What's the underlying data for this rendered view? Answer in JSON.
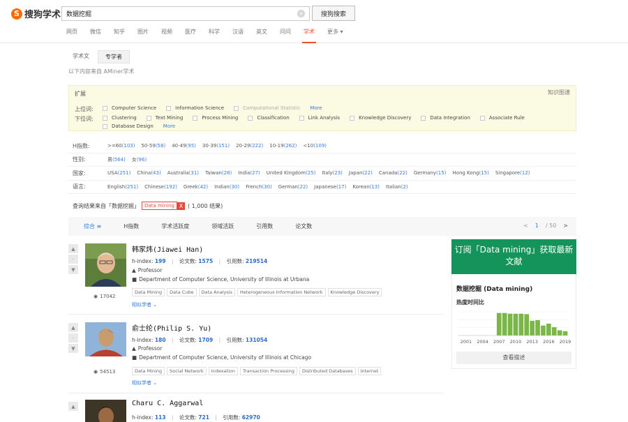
{
  "header": {
    "logo_text": "搜狗学术",
    "search_value": "数据挖掘",
    "search_button": "搜狗搜索",
    "nav": [
      "网页",
      "微信",
      "知乎",
      "图片",
      "视频",
      "医疗",
      "科学",
      "汉语",
      "英文",
      "问问",
      "学术",
      "更多 ▾"
    ],
    "active_nav": "学术"
  },
  "subtabs": [
    "学术文",
    "专学者"
  ],
  "source_line": "以下内容来自 AMiner学术",
  "expand": {
    "label": "扩展",
    "kg_link": "知识图谱",
    "upper_label": "上位词:",
    "upper_terms": [
      "Computer Science",
      "Information Science",
      "Computational Statistic",
      "More"
    ],
    "lower_label": "下位词:",
    "lower_terms_1": [
      "Clustering",
      "Text Mining",
      "Process Mining",
      "Classification",
      "Link Analysis",
      "Knowledge Discovery",
      "Data Integration",
      "Associate Rule"
    ],
    "lower_terms_2": [
      "Database Design",
      "More"
    ]
  },
  "filters": [
    {
      "label": "H指数:",
      "items": [
        [
          ">=60",
          "(103)"
        ],
        [
          "50-59",
          "(58)"
        ],
        [
          "40-49",
          "(95)"
        ],
        [
          "30-39",
          "(151)"
        ],
        [
          "20-29",
          "(222)"
        ],
        [
          "10-19",
          "(262)"
        ],
        [
          "<10",
          "(109)"
        ]
      ]
    },
    {
      "label": "性别:",
      "items": [
        [
          "男",
          "(564)"
        ],
        [
          "女",
          "(96)"
        ]
      ]
    },
    {
      "label": "国家:",
      "items": [
        [
          "USA",
          "(251)"
        ],
        [
          "China",
          "(43)"
        ],
        [
          "Australia",
          "(31)"
        ],
        [
          "Taiwan",
          "(28)"
        ],
        [
          "India",
          "(27)"
        ],
        [
          "United Kingdom",
          "(25)"
        ],
        [
          "Italy",
          "(23)"
        ],
        [
          "Japan",
          "(22)"
        ],
        [
          "Canada",
          "(22)"
        ],
        [
          "Germany",
          "(15)"
        ],
        [
          "Hong Kong",
          "(15)"
        ],
        [
          "Singapore",
          "(12)"
        ]
      ]
    },
    {
      "label": "语言:",
      "items": [
        [
          "English",
          "(251)"
        ],
        [
          "Chinese",
          "(192)"
        ],
        [
          "Greek",
          "(42)"
        ],
        [
          "Indian",
          "(30)"
        ],
        [
          "French",
          "(30)"
        ],
        [
          "German",
          "(22)"
        ],
        [
          "Japanese",
          "(17)"
        ],
        [
          "Korean",
          "(13)"
        ],
        [
          "Italian",
          "(2)"
        ]
      ]
    }
  ],
  "status": {
    "prefix": "查询结果来自「数据挖掘」",
    "tag": "Data mining",
    "x": "X",
    "count": "( 1,000 结果)"
  },
  "sortbar": {
    "items": [
      "综合 ≡",
      "H指数",
      "学术活跃度",
      "领域活跃",
      "引用数",
      "论文数"
    ],
    "pager_prev": "<",
    "pager_cur": "1",
    "pager_total": "/ 50",
    "pager_next": ">"
  },
  "people": [
    {
      "name": "韩家炜(Jiawei Han)",
      "hindex": "199",
      "papers": "1575",
      "citations": "219514",
      "role": "Professor",
      "affil": "Department of Computer Science, University of Illinois at Urbana",
      "tags": [
        "Data Mining",
        "Data Cube",
        "Data Analysis",
        "Heterogeneous Information Network",
        "Knowledge Discovery"
      ],
      "views": "17042",
      "more": "相似学者 ⌄"
    },
    {
      "name": "俞士纶(Philip S. Yu)",
      "hindex": "180",
      "papers": "1709",
      "citations": "131054",
      "role": "Professor",
      "affil": "Department of Computer Science, University of Illinois at Chicago",
      "tags": [
        "Data Mining",
        "Social Network",
        "Indexation",
        "Transaction Processing",
        "Distributed Databases",
        "Internet"
      ],
      "views": "54513",
      "more": "相似学者 ⌄"
    },
    {
      "name": "Charu C. Aggarwal",
      "hindex": "113",
      "papers": "721",
      "citations": "62970"
    }
  ],
  "labels": {
    "hindex": "h-index:",
    "papers": "论文数:",
    "citations": "引用数:",
    "sep": "|"
  },
  "panel": {
    "subscribe": "订阅「Data mining」获取最新文献",
    "trend_title": "数据挖掘 (Data mining)",
    "trend_sub": "热度时间比",
    "button": "查看描述",
    "accent": "#14945a",
    "bar_color": "#7ab648"
  },
  "chart_data": {
    "type": "bar",
    "x_tick_labels": [
      "2001",
      "2004",
      "2007",
      "2010",
      "2013",
      "2016",
      "2019"
    ],
    "x": [
      2000,
      2001,
      2002,
      2003,
      2004,
      2005,
      2006,
      2007,
      2008,
      2009,
      2010,
      2011,
      2012,
      2013,
      2014,
      2015,
      2016,
      2017,
      2018,
      2019
    ],
    "values": [
      0,
      0,
      0,
      0,
      0,
      0,
      0,
      0.95,
      0.95,
      0.92,
      0.92,
      0.92,
      0.9,
      0.62,
      0.65,
      0.42,
      0.5,
      0.35,
      0.22,
      0.18
    ],
    "ylim": [
      0,
      1
    ],
    "grid": true
  }
}
